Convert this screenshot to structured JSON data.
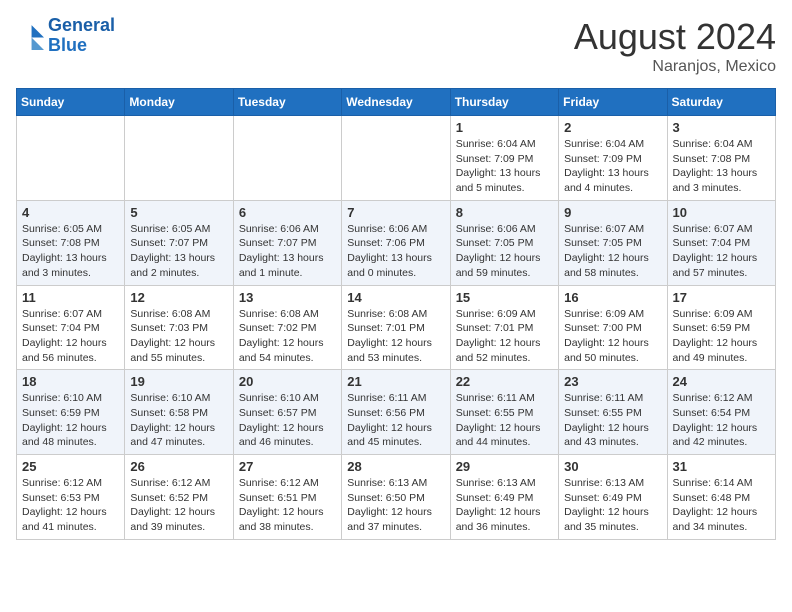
{
  "header": {
    "logo_line1": "General",
    "logo_line2": "Blue",
    "month_year": "August 2024",
    "location": "Naranjos, Mexico"
  },
  "days_of_week": [
    "Sunday",
    "Monday",
    "Tuesday",
    "Wednesday",
    "Thursday",
    "Friday",
    "Saturday"
  ],
  "weeks": [
    [
      {
        "day": "",
        "info": ""
      },
      {
        "day": "",
        "info": ""
      },
      {
        "day": "",
        "info": ""
      },
      {
        "day": "",
        "info": ""
      },
      {
        "day": "1",
        "info": "Sunrise: 6:04 AM\nSunset: 7:09 PM\nDaylight: 13 hours\nand 5 minutes."
      },
      {
        "day": "2",
        "info": "Sunrise: 6:04 AM\nSunset: 7:09 PM\nDaylight: 13 hours\nand 4 minutes."
      },
      {
        "day": "3",
        "info": "Sunrise: 6:04 AM\nSunset: 7:08 PM\nDaylight: 13 hours\nand 3 minutes."
      }
    ],
    [
      {
        "day": "4",
        "info": "Sunrise: 6:05 AM\nSunset: 7:08 PM\nDaylight: 13 hours\nand 3 minutes."
      },
      {
        "day": "5",
        "info": "Sunrise: 6:05 AM\nSunset: 7:07 PM\nDaylight: 13 hours\nand 2 minutes."
      },
      {
        "day": "6",
        "info": "Sunrise: 6:06 AM\nSunset: 7:07 PM\nDaylight: 13 hours\nand 1 minute."
      },
      {
        "day": "7",
        "info": "Sunrise: 6:06 AM\nSunset: 7:06 PM\nDaylight: 13 hours\nand 0 minutes."
      },
      {
        "day": "8",
        "info": "Sunrise: 6:06 AM\nSunset: 7:05 PM\nDaylight: 12 hours\nand 59 minutes."
      },
      {
        "day": "9",
        "info": "Sunrise: 6:07 AM\nSunset: 7:05 PM\nDaylight: 12 hours\nand 58 minutes."
      },
      {
        "day": "10",
        "info": "Sunrise: 6:07 AM\nSunset: 7:04 PM\nDaylight: 12 hours\nand 57 minutes."
      }
    ],
    [
      {
        "day": "11",
        "info": "Sunrise: 6:07 AM\nSunset: 7:04 PM\nDaylight: 12 hours\nand 56 minutes."
      },
      {
        "day": "12",
        "info": "Sunrise: 6:08 AM\nSunset: 7:03 PM\nDaylight: 12 hours\nand 55 minutes."
      },
      {
        "day": "13",
        "info": "Sunrise: 6:08 AM\nSunset: 7:02 PM\nDaylight: 12 hours\nand 54 minutes."
      },
      {
        "day": "14",
        "info": "Sunrise: 6:08 AM\nSunset: 7:01 PM\nDaylight: 12 hours\nand 53 minutes."
      },
      {
        "day": "15",
        "info": "Sunrise: 6:09 AM\nSunset: 7:01 PM\nDaylight: 12 hours\nand 52 minutes."
      },
      {
        "day": "16",
        "info": "Sunrise: 6:09 AM\nSunset: 7:00 PM\nDaylight: 12 hours\nand 50 minutes."
      },
      {
        "day": "17",
        "info": "Sunrise: 6:09 AM\nSunset: 6:59 PM\nDaylight: 12 hours\nand 49 minutes."
      }
    ],
    [
      {
        "day": "18",
        "info": "Sunrise: 6:10 AM\nSunset: 6:59 PM\nDaylight: 12 hours\nand 48 minutes."
      },
      {
        "day": "19",
        "info": "Sunrise: 6:10 AM\nSunset: 6:58 PM\nDaylight: 12 hours\nand 47 minutes."
      },
      {
        "day": "20",
        "info": "Sunrise: 6:10 AM\nSunset: 6:57 PM\nDaylight: 12 hours\nand 46 minutes."
      },
      {
        "day": "21",
        "info": "Sunrise: 6:11 AM\nSunset: 6:56 PM\nDaylight: 12 hours\nand 45 minutes."
      },
      {
        "day": "22",
        "info": "Sunrise: 6:11 AM\nSunset: 6:55 PM\nDaylight: 12 hours\nand 44 minutes."
      },
      {
        "day": "23",
        "info": "Sunrise: 6:11 AM\nSunset: 6:55 PM\nDaylight: 12 hours\nand 43 minutes."
      },
      {
        "day": "24",
        "info": "Sunrise: 6:12 AM\nSunset: 6:54 PM\nDaylight: 12 hours\nand 42 minutes."
      }
    ],
    [
      {
        "day": "25",
        "info": "Sunrise: 6:12 AM\nSunset: 6:53 PM\nDaylight: 12 hours\nand 41 minutes."
      },
      {
        "day": "26",
        "info": "Sunrise: 6:12 AM\nSunset: 6:52 PM\nDaylight: 12 hours\nand 39 minutes."
      },
      {
        "day": "27",
        "info": "Sunrise: 6:12 AM\nSunset: 6:51 PM\nDaylight: 12 hours\nand 38 minutes."
      },
      {
        "day": "28",
        "info": "Sunrise: 6:13 AM\nSunset: 6:50 PM\nDaylight: 12 hours\nand 37 minutes."
      },
      {
        "day": "29",
        "info": "Sunrise: 6:13 AM\nSunset: 6:49 PM\nDaylight: 12 hours\nand 36 minutes."
      },
      {
        "day": "30",
        "info": "Sunrise: 6:13 AM\nSunset: 6:49 PM\nDaylight: 12 hours\nand 35 minutes."
      },
      {
        "day": "31",
        "info": "Sunrise: 6:14 AM\nSunset: 6:48 PM\nDaylight: 12 hours\nand 34 minutes."
      }
    ]
  ]
}
